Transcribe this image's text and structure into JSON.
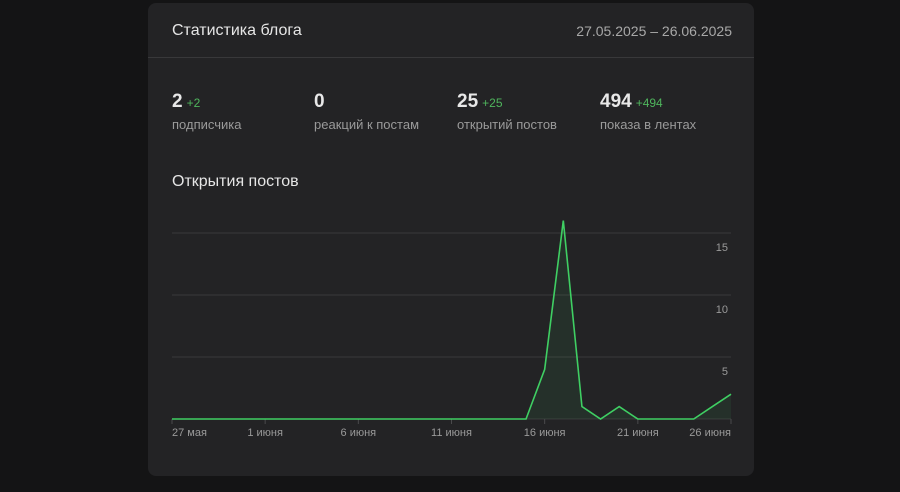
{
  "header": {
    "title": "Статистика блога",
    "date_range": "27.05.2025 – 26.06.2025"
  },
  "stats": [
    {
      "value": "2",
      "delta": "+2",
      "label": "подписчика"
    },
    {
      "value": "0",
      "delta": "",
      "label": "реакций к постам"
    },
    {
      "value": "25",
      "delta": "+25",
      "label": "открытий постов"
    },
    {
      "value": "494",
      "delta": "+494",
      "label": "показа в лентах"
    }
  ],
  "chart_data": {
    "type": "line",
    "title": "Открытия постов",
    "x": [
      "27 мая",
      "28 мая",
      "29 мая",
      "30 мая",
      "31 мая",
      "1 июня",
      "2 июня",
      "3 июня",
      "4 июня",
      "5 июня",
      "6 июня",
      "7 июня",
      "8 июня",
      "9 июня",
      "10 июня",
      "11 июня",
      "12 июня",
      "13 июня",
      "14 июня",
      "15 июня",
      "16 июня",
      "17 июня",
      "18 июня",
      "19 июня",
      "20 июня",
      "21 июня",
      "22 июня",
      "23 июня",
      "24 июня",
      "25 июня",
      "26 июня"
    ],
    "values": [
      0,
      0,
      0,
      0,
      0,
      0,
      0,
      0,
      0,
      0,
      0,
      0,
      0,
      0,
      0,
      0,
      0,
      0,
      0,
      0,
      4,
      16,
      1,
      0,
      1,
      0,
      0,
      0,
      0,
      1,
      2
    ],
    "x_ticks": [
      "27 мая",
      "1 июня",
      "6 июня",
      "11 июня",
      "16 июня",
      "21 июня",
      "26 июня"
    ],
    "y_ticks": [
      "5",
      "10",
      "15"
    ],
    "ylim": [
      0,
      15
    ],
    "grid": true,
    "line_color": "#3fcf63"
  }
}
